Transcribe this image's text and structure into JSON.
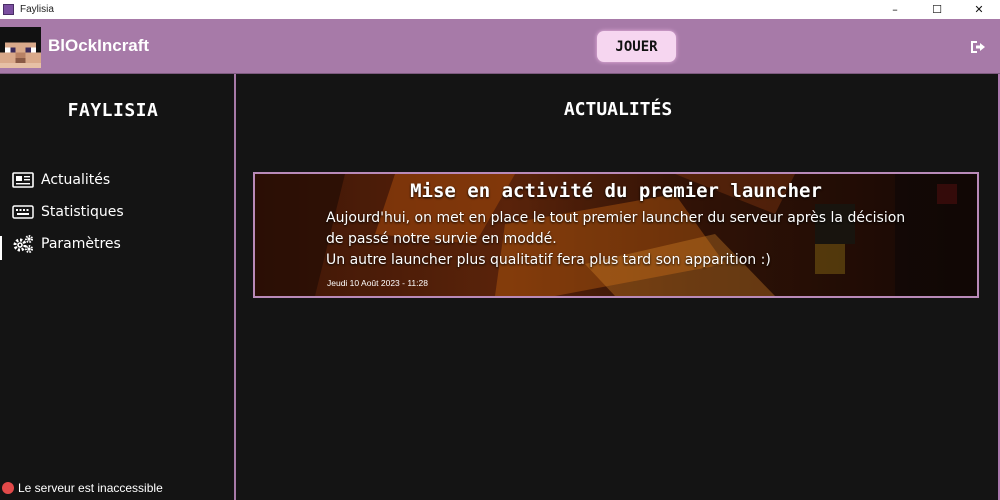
{
  "window": {
    "title": "Faylisia",
    "minimize": "–",
    "maximize": "☐",
    "close": "✕"
  },
  "header": {
    "brand": "BlOckIncraft",
    "play_label": "JOUER",
    "logout_icon": "sign-out-icon"
  },
  "sidebar": {
    "username": "FAYLISIA",
    "items": [
      {
        "label": "Actualités",
        "icon": "newspaper-icon"
      },
      {
        "label": "Statistiques",
        "icon": "keyboard-icon"
      },
      {
        "label": "Paramètres",
        "icon": "gears-icon"
      }
    ],
    "server_status": "Le serveur est inaccessible",
    "status_color": "#e24a4a"
  },
  "main": {
    "title": "ACTUALITÉS",
    "news": [
      {
        "title": "Mise en activité du premier launcher",
        "body_lines": [
          "Aujourd'hui, on met en place le tout premier launcher du serveur après la décision",
          "de passé notre survie en moddé.",
          "Un autre launcher plus qualitatif fera plus tard son apparition :)"
        ],
        "date": "Jeudi 10 Août 2023 - 11:28"
      }
    ]
  },
  "colors": {
    "accent": "#a77aa8",
    "play_button": "#f6d6f0",
    "background": "#141414"
  }
}
